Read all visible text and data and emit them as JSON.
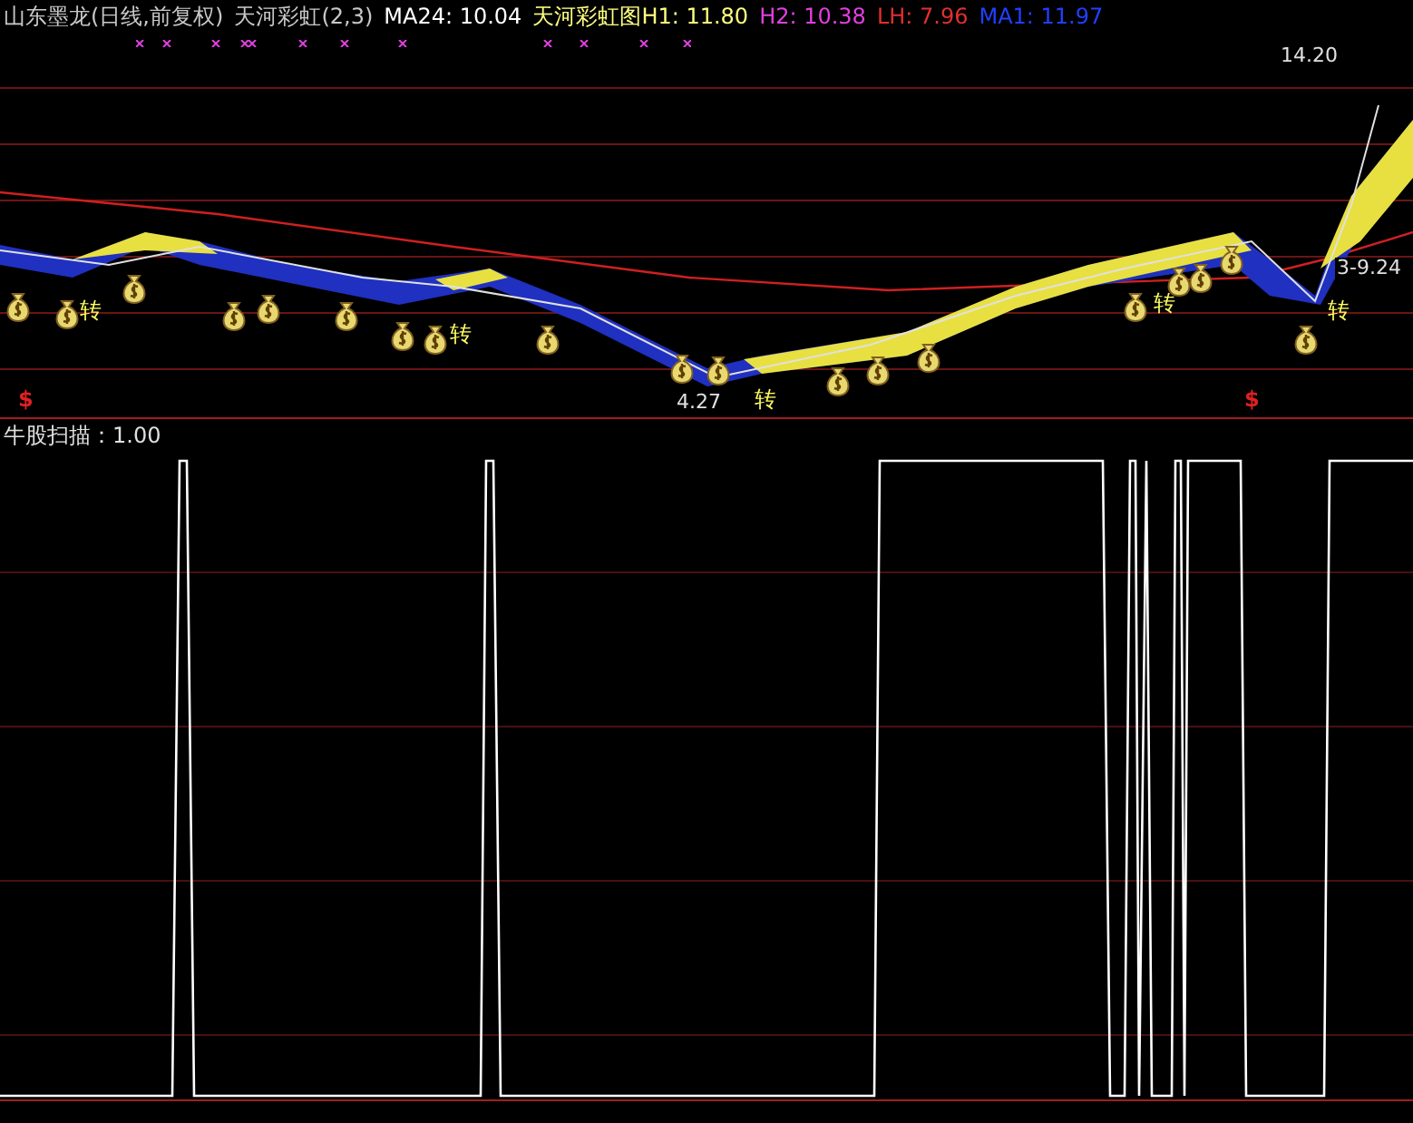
{
  "legend": [
    {
      "text": "山东墨龙(日线,前复权)",
      "color": "#c8c8c8"
    },
    {
      "text": "天河彩虹(2,3)",
      "color": "#c8c8c8"
    },
    {
      "text": "MA24: 10.04",
      "color": "#ffffff"
    },
    {
      "text": "天河彩虹图H1: 11.80",
      "color": "#ffff80"
    },
    {
      "text": "H2: 10.38",
      "color": "#e040e0"
    },
    {
      "text": "LH: 7.96",
      "color": "#e03030"
    },
    {
      "text": "MA1: 11.97",
      "color": "#2040ff"
    }
  ],
  "price_labels": [
    "14.20",
    "4.27",
    "3-9.24"
  ],
  "turn_marks": [
    "转",
    "转",
    "转",
    "转",
    "转"
  ],
  "signal_marks": [
    "$",
    "$"
  ],
  "indicator": {
    "label": "牛股扫描：1.00"
  }
}
